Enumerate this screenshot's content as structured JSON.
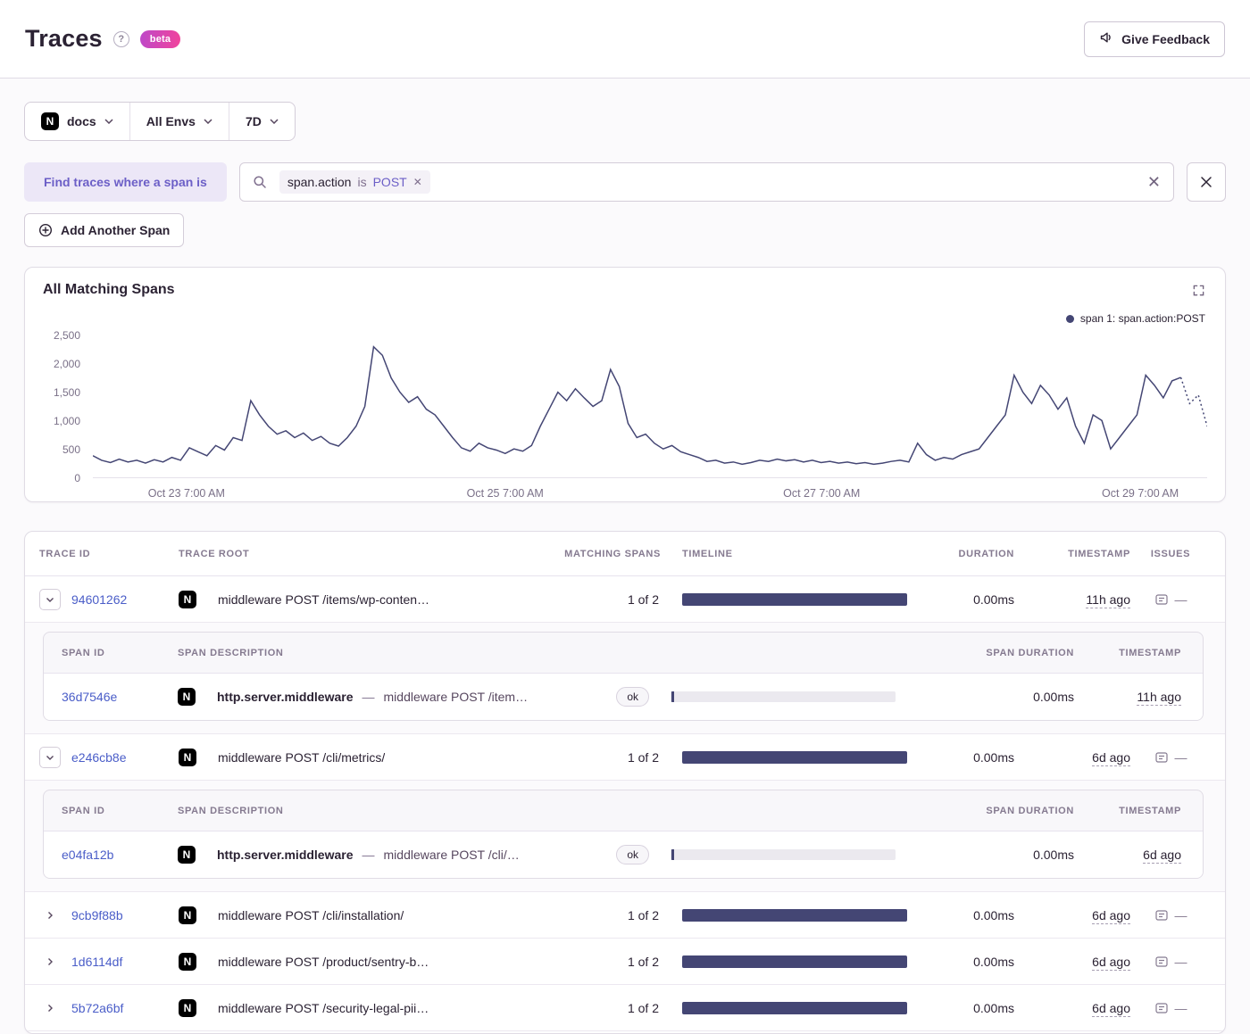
{
  "colors": {
    "accent_purple": "#6c5fc7",
    "link_blue": "#4a5dc8",
    "series": "#444674",
    "bar_track": "#ebe9ef"
  },
  "header": {
    "title": "Traces",
    "beta_label": "beta",
    "feedback_label": "Give Feedback"
  },
  "filters": {
    "project": "docs",
    "environment": "All Envs",
    "date_range": "7D"
  },
  "search": {
    "chip_label": "Find traces where a span is",
    "token": {
      "key": "span.action",
      "operator": "is",
      "value": "POST"
    },
    "add_span_label": "Add Another Span"
  },
  "chart": {
    "title": "All Matching Spans",
    "legend": "span 1: span.action:POST"
  },
  "chart_data": {
    "type": "line",
    "title": "All Matching Spans",
    "xlabel": "",
    "ylabel": "",
    "ylim": [
      0,
      2500
    ],
    "ytick_labels": [
      "0",
      "500",
      "1,000",
      "1,500",
      "2,000",
      "2,500"
    ],
    "xticks": [
      "Oct 23 7:00 AM",
      "Oct 25 7:00 AM",
      "Oct 27 7:00 AM",
      "Oct 29 7:00 AM"
    ],
    "legend_entries": [
      "span 1: span.action:POST"
    ],
    "legend_position": "top-right",
    "grid": false,
    "color": "#444674",
    "series": [
      {
        "name": "span 1: span.action:POST",
        "values": [
          380,
          300,
          260,
          320,
          270,
          300,
          250,
          310,
          270,
          350,
          300,
          520,
          450,
          380,
          560,
          480,
          700,
          650,
          1350,
          1100,
          900,
          760,
          820,
          700,
          780,
          650,
          720,
          600,
          550,
          700,
          900,
          1250,
          2300,
          2150,
          1750,
          1500,
          1320,
          1420,
          1200,
          1100,
          900,
          700,
          520,
          460,
          600,
          520,
          480,
          420,
          500,
          460,
          560,
          900,
          1200,
          1500,
          1350,
          1560,
          1400,
          1250,
          1350,
          1900,
          1600,
          950,
          700,
          760,
          600,
          500,
          560,
          450,
          400,
          350,
          280,
          300,
          250,
          270,
          230,
          260,
          300,
          280,
          320,
          290,
          310,
          270,
          300,
          260,
          280,
          250,
          270,
          240,
          260,
          230,
          250,
          280,
          300,
          270,
          600,
          400,
          300,
          350,
          320,
          400,
          450,
          500,
          700,
          900,
          1100,
          1800,
          1500,
          1300,
          1620,
          1450,
          1200,
          1400,
          900,
          600,
          1100,
          1000,
          500,
          700,
          900,
          1100,
          1800,
          1620,
          1400,
          1700,
          1760,
          1300,
          1450,
          900
        ]
      }
    ]
  },
  "table": {
    "headers": [
      "TRACE ID",
      "TRACE ROOT",
      "MATCHING SPANS",
      "TIMELINE",
      "DURATION",
      "TIMESTAMP",
      "ISSUES"
    ],
    "sub_headers": [
      "SPAN ID",
      "SPAN DESCRIPTION",
      "SPAN DURATION",
      "TIMESTAMP"
    ],
    "rows": [
      {
        "id": "94601262",
        "root": "middleware POST /items/wp-conten…",
        "matching": "1 of 2",
        "duration": "0.00ms",
        "timestamp": "11h ago",
        "issues": "—",
        "expanded": true,
        "children": [
          {
            "id": "36d7546e",
            "op": "http.server.middleware",
            "desc": "middleware POST /item…",
            "status": "ok",
            "duration": "0.00ms",
            "timestamp": "11h ago"
          }
        ]
      },
      {
        "id": "e246cb8e",
        "root": "middleware POST /cli/metrics/",
        "matching": "1 of 2",
        "duration": "0.00ms",
        "timestamp": "6d ago",
        "issues": "—",
        "expanded": true,
        "children": [
          {
            "id": "e04fa12b",
            "op": "http.server.middleware",
            "desc": "middleware POST /cli/…",
            "status": "ok",
            "duration": "0.00ms",
            "timestamp": "6d ago"
          }
        ]
      },
      {
        "id": "9cb9f88b",
        "root": "middleware POST /cli/installation/",
        "matching": "1 of 2",
        "duration": "0.00ms",
        "timestamp": "6d ago",
        "issues": "—",
        "expanded": false
      },
      {
        "id": "1d6114df",
        "root": "middleware POST /product/sentry-b…",
        "matching": "1 of 2",
        "duration": "0.00ms",
        "timestamp": "6d ago",
        "issues": "—",
        "expanded": false
      },
      {
        "id": "5b72a6bf",
        "root": "middleware POST /security-legal-pii…",
        "matching": "1 of 2",
        "duration": "0.00ms",
        "timestamp": "6d ago",
        "issues": "—",
        "expanded": false
      }
    ]
  }
}
